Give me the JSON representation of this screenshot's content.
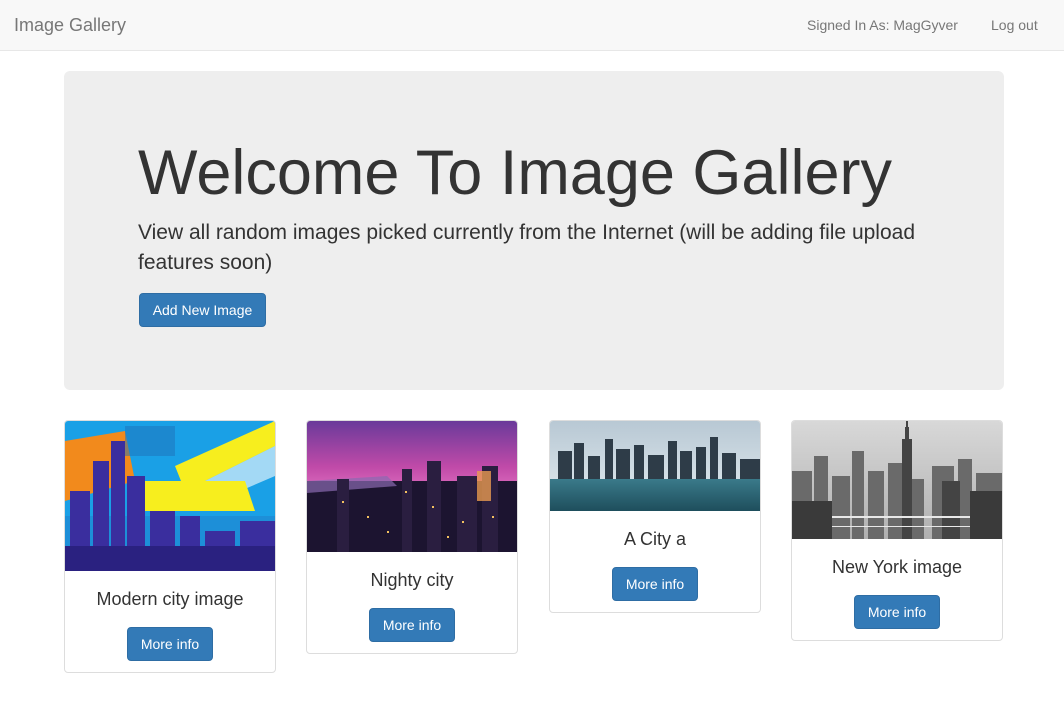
{
  "navbar": {
    "brand": "Image Gallery",
    "signed_in": "Signed In As: MagGyver",
    "logout": "Log out"
  },
  "jumbotron": {
    "title": "Welcome To Image Gallery",
    "lead": "View all random images picked currently from the Internet (will be adding file upload features soon)",
    "add_button": "Add New Image"
  },
  "gallery": [
    {
      "caption": "Modern city image",
      "button": "More info"
    },
    {
      "caption": "Nighty city",
      "button": "More info"
    },
    {
      "caption": "A City a",
      "button": "More info"
    },
    {
      "caption": "New York image",
      "button": "More info"
    }
  ],
  "colors": {
    "primary": "#337ab7",
    "navbar_bg": "#f8f8f8",
    "jumbotron_bg": "#eeeeee"
  }
}
